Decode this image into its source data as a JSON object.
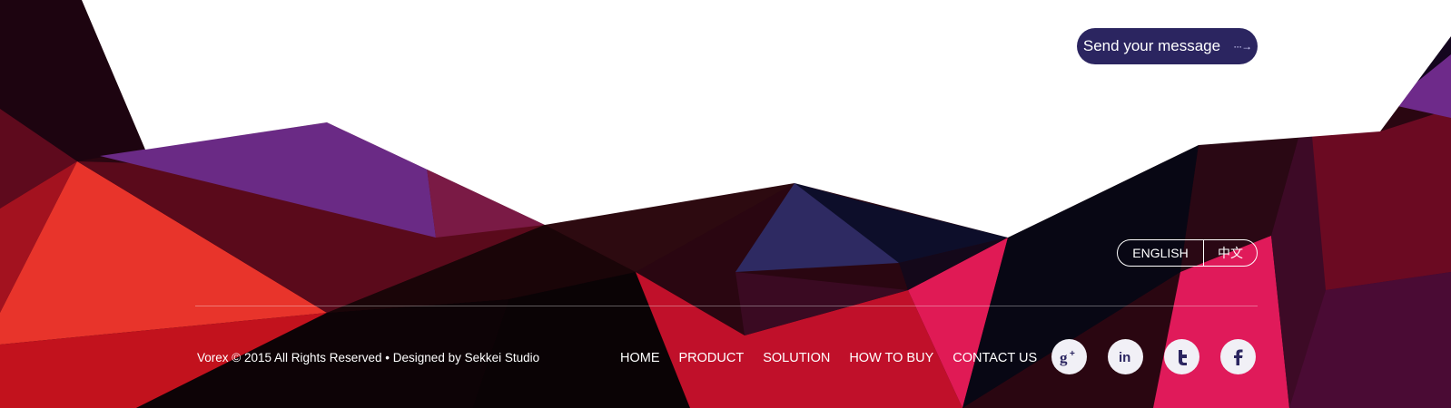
{
  "cta": {
    "label": "Send your message",
    "arrow": "···→"
  },
  "language": {
    "english": "ENGLISH",
    "chinese": "中文"
  },
  "footer": {
    "copyright": "Vorex © 2015 All Rights Reserved • Designed by Sekkei Studio",
    "nav": [
      "HOME",
      "PRODUCT",
      "SOLUTION",
      "HOW TO BUY",
      "CONTACT US"
    ],
    "social": [
      "google-plus-icon",
      "linkedin-icon",
      "twitter-icon",
      "facebook-icon"
    ]
  },
  "colors": {
    "accent": "#2b2560",
    "text": "#ffffff"
  }
}
